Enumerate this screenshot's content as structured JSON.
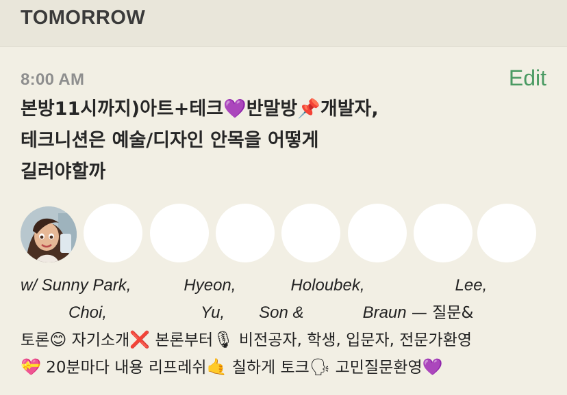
{
  "header": {
    "title": "TOMORROW"
  },
  "event": {
    "time": "8:00 AM",
    "edit_label": "Edit",
    "title_line1": "본방11시까지)아트+테크💜반말방📌개발자,",
    "title_line2": "테크니션은 예술/디자인 안목을 어떻게",
    "title_line3": "길러야할까"
  },
  "avatars": [
    {
      "name": "avatar-photo",
      "type": "photo"
    },
    {
      "name": "avatar-2"
    },
    {
      "name": "avatar-3"
    },
    {
      "name": "avatar-4"
    },
    {
      "name": "avatar-5"
    },
    {
      "name": "avatar-6"
    },
    {
      "name": "avatar-7"
    },
    {
      "name": "avatar-8"
    }
  ],
  "speakers": {
    "prefix": "w/ Sunny Park,",
    "n1": "Hyeon,",
    "n2": "Holoubek,",
    "n3": "Lee,",
    "n4": "Choi,",
    "n5": "Yu,",
    "n6": "Son &",
    "n7": "Braun",
    "dash": " — 질문&",
    "line3_a": "토론",
    "line3_b": " 자기소개",
    "line3_c": " 본론부터",
    "line3_d": " 비전공자, 학생, 입문자, 전문가환영",
    "line4_a": " 20분마다 내용 리프레쉬",
    "line4_b": " 칠하게 토크",
    "line4_c": " 고민질문환영"
  },
  "emojis": {
    "smile": "😊",
    "cross": "❌",
    "mic": "🎙",
    "gift_heart": "💝",
    "call_me": "🤙",
    "speaking_head": "🗣",
    "purple_heart": "💜"
  }
}
